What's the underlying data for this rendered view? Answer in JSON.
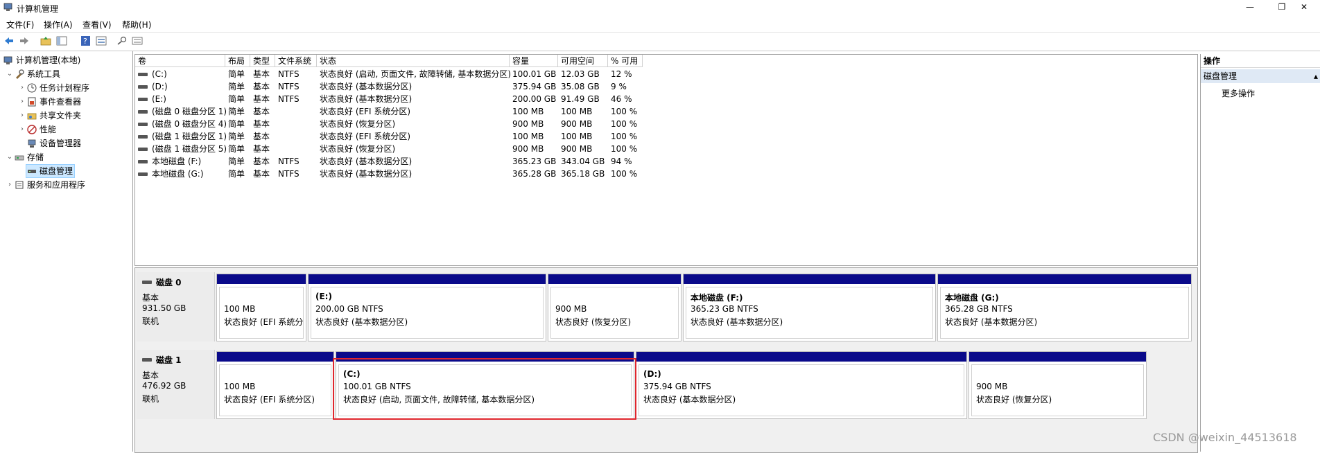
{
  "window": {
    "title": "计算机管理",
    "controls": {
      "minimize": "—",
      "restore": "❐",
      "close": "✕"
    }
  },
  "menu": [
    "文件(F)",
    "操作(A)",
    "查看(V)",
    "帮助(H)"
  ],
  "toolbar": [
    "back-icon",
    "forward-icon",
    "up-folder-icon",
    "show-hide-tree-icon",
    "help-icon",
    "properties-icon",
    "search-icon",
    "list-view-icon"
  ],
  "tree": {
    "root": "计算机管理(本地)",
    "system_tools": "系统工具",
    "task_scheduler": "任务计划程序",
    "event_viewer": "事件查看器",
    "shared_folders": "共享文件夹",
    "performance": "性能",
    "device_manager": "设备管理器",
    "storage": "存储",
    "disk_management": "磁盘管理",
    "services_apps": "服务和应用程序"
  },
  "volume_table": {
    "headers": [
      "卷",
      "布局",
      "类型",
      "文件系统",
      "状态",
      "容量",
      "可用空间",
      "% 可用"
    ],
    "rows": [
      [
        "(C:)",
        "简单",
        "基本",
        "NTFS",
        "状态良好 (启动, 页面文件, 故障转储, 基本数据分区)",
        "100.01 GB",
        "12.03 GB",
        "12 %"
      ],
      [
        "(D:)",
        "简单",
        "基本",
        "NTFS",
        "状态良好 (基本数据分区)",
        "375.94 GB",
        "35.08 GB",
        "9 %"
      ],
      [
        "(E:)",
        "简单",
        "基本",
        "NTFS",
        "状态良好 (基本数据分区)",
        "200.00 GB",
        "91.49 GB",
        "46 %"
      ],
      [
        "(磁盘 0 磁盘分区 1)",
        "简单",
        "基本",
        "",
        "状态良好 (EFI 系统分区)",
        "100 MB",
        "100 MB",
        "100 %"
      ],
      [
        "(磁盘 0 磁盘分区 4)",
        "简单",
        "基本",
        "",
        "状态良好 (恢复分区)",
        "900 MB",
        "900 MB",
        "100 %"
      ],
      [
        "(磁盘 1 磁盘分区 1)",
        "简单",
        "基本",
        "",
        "状态良好 (EFI 系统分区)",
        "100 MB",
        "100 MB",
        "100 %"
      ],
      [
        "(磁盘 1 磁盘分区 5)",
        "简单",
        "基本",
        "",
        "状态良好 (恢复分区)",
        "900 MB",
        "900 MB",
        "100 %"
      ],
      [
        "本地磁盘 (F:)",
        "简单",
        "基本",
        "NTFS",
        "状态良好 (基本数据分区)",
        "365.23 GB",
        "343.04 GB",
        "94 %"
      ],
      [
        "本地磁盘 (G:)",
        "简单",
        "基本",
        "NTFS",
        "状态良好 (基本数据分区)",
        "365.28 GB",
        "365.18 GB",
        "100 %"
      ]
    ]
  },
  "disks": [
    {
      "name": "磁盘 0",
      "type": "基本",
      "size": "931.50 GB",
      "status": "联机",
      "partitions": [
        {
          "title": "",
          "size": "100 MB",
          "status": "状态良好 (EFI 系统分区)"
        },
        {
          "title": "(E:)",
          "size": "200.00 GB NTFS",
          "status": "状态良好 (基本数据分区)"
        },
        {
          "title": "",
          "size": "900 MB",
          "status": "状态良好 (恢复分区)"
        },
        {
          "title": "本地磁盘  (F:)",
          "size": "365.23 GB NTFS",
          "status": "状态良好 (基本数据分区)"
        },
        {
          "title": "本地磁盘  (G:)",
          "size": "365.28 GB NTFS",
          "status": "状态良好 (基本数据分区)"
        }
      ]
    },
    {
      "name": "磁盘 1",
      "type": "基本",
      "size": "476.92 GB",
      "status": "联机",
      "partitions": [
        {
          "title": "",
          "size": "100 MB",
          "status": "状态良好 (EFI 系统分区)"
        },
        {
          "title": "(C:)",
          "size": "100.01 GB NTFS",
          "status": "状态良好 (启动, 页面文件, 故障转储, 基本数据分区)"
        },
        {
          "title": "(D:)",
          "size": "375.94 GB NTFS",
          "status": "状态良好 (基本数据分区)"
        },
        {
          "title": "",
          "size": "900 MB",
          "status": "状态良好 (恢复分区)"
        }
      ]
    }
  ],
  "actions": {
    "header": "操作",
    "section": "磁盘管理",
    "more": "更多操作"
  },
  "watermark": "CSDN @weixin_44513618",
  "colors": {
    "partition_bar": "#0a0a8a",
    "highlight": "#e0262d",
    "selection": "#cce8ff"
  }
}
